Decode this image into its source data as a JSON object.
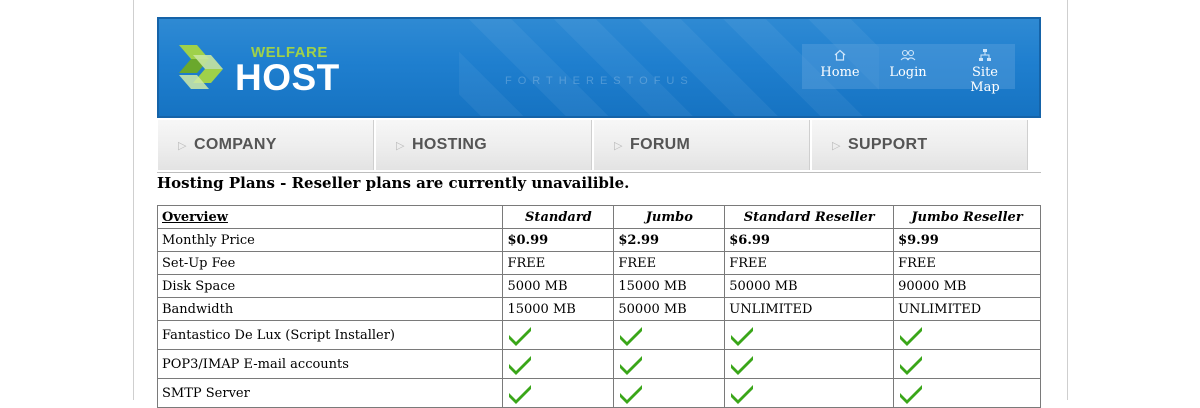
{
  "brand": {
    "logo_top": "WELFARE",
    "logo_main": "HOST",
    "tagline": "FORTHERESTOFUS",
    "colors": {
      "banner": "#1f7fcf",
      "logo_green": "#9fd14a"
    }
  },
  "topnav": [
    {
      "label": "Home",
      "icon": "home-icon"
    },
    {
      "label": "Login",
      "icon": "users-icon"
    },
    {
      "label": "Site Map",
      "icon": "sitemap-icon"
    }
  ],
  "tabs": [
    {
      "label": "COMPANY"
    },
    {
      "label": "HOSTING"
    },
    {
      "label": "FORUM"
    },
    {
      "label": "SUPPORT"
    }
  ],
  "heading": "Hosting Plans - Reseller plans are currently unavailible.",
  "table": {
    "headers": [
      "Overview",
      "Standard",
      "Jumbo",
      "Standard Reseller",
      "Jumbo Reseller"
    ],
    "rows": [
      {
        "label": "Monthly Price",
        "values": [
          "$0.99",
          "$2.99",
          "$6.99",
          "$9.99"
        ]
      },
      {
        "label": "Set-Up Fee",
        "values": [
          "FREE",
          "FREE",
          "FREE",
          "FREE"
        ]
      },
      {
        "label": "Disk Space",
        "values": [
          "5000 MB",
          "15000 MB",
          "50000 MB",
          "90000 MB"
        ]
      },
      {
        "label": "Bandwidth",
        "values": [
          "15000 MB",
          "50000 MB",
          "UNLIMITED",
          "UNLIMITED"
        ]
      }
    ],
    "feature_rows": [
      {
        "label": "Fantastico De Lux (Script Installer)",
        "included": [
          true,
          true,
          true,
          true
        ]
      },
      {
        "label": "POP3/IMAP E-mail accounts",
        "included": [
          true,
          true,
          true,
          true
        ]
      },
      {
        "label": "SMTP Server",
        "included": [
          true,
          true,
          true,
          true
        ]
      }
    ],
    "check_color": "#3aa619"
  }
}
